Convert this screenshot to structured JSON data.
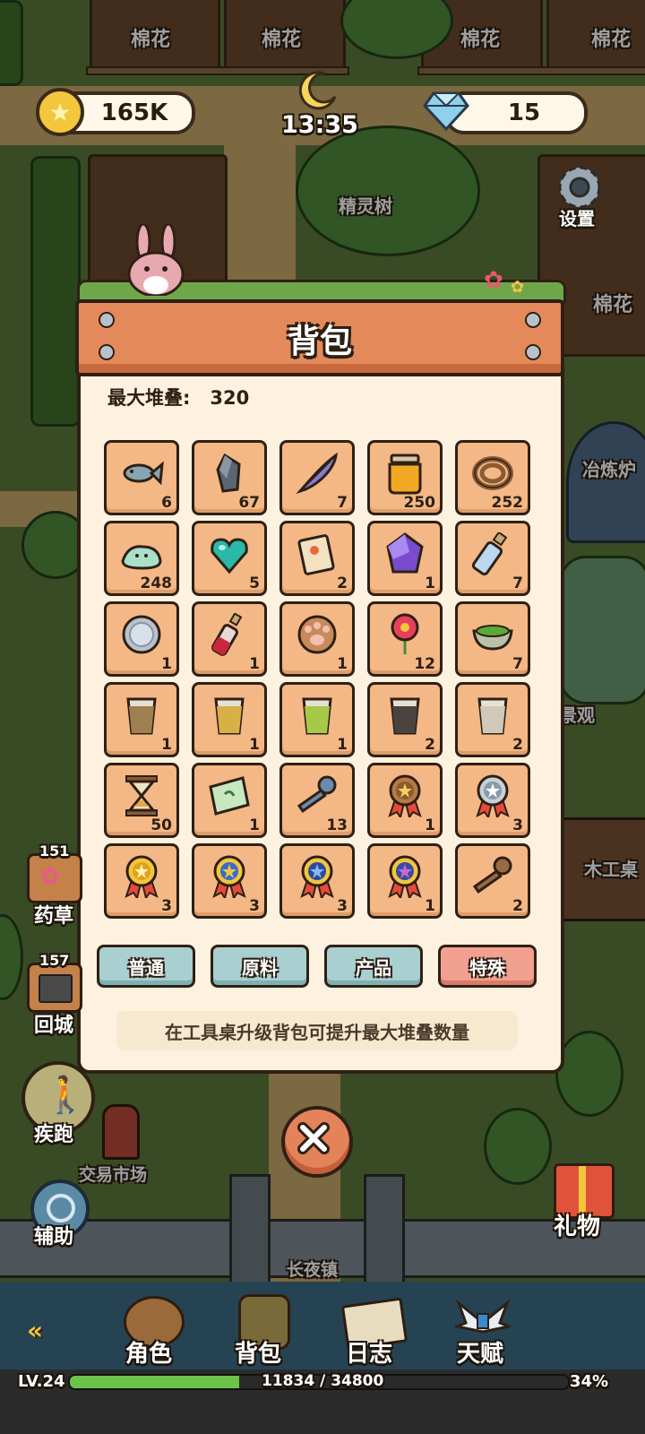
{
  "hud": {
    "coins": "165K",
    "time": "13:35",
    "gems": "15",
    "settings_label": "设置"
  },
  "map_labels": {
    "cotton_1": "棉花",
    "cotton_2": "棉花",
    "cotton_3": "棉花",
    "cotton_4": "棉花",
    "cotton_5": "棉花",
    "spirit_tree": "精灵树",
    "smelting": "冶炼炉",
    "scenery": "景观",
    "workbench": "木工桌",
    "trade_market": "交易市场",
    "town": "长夜镇"
  },
  "side_buttons": {
    "herb_count": "151",
    "herb_label": "药草",
    "return_count": "157",
    "return_label": "回城",
    "sprint_label": "疾跑",
    "assist_label": "辅助",
    "gift_label": "礼物"
  },
  "panel": {
    "title": "背包",
    "max_stack_label": "最大堆叠:",
    "max_stack_value": "320",
    "items": [
      {
        "name": "fish-icon",
        "qty": "6"
      },
      {
        "name": "stone-icon",
        "qty": "67"
      },
      {
        "name": "feather-icon",
        "qty": "7"
      },
      {
        "name": "honey-jar-icon",
        "qty": "250"
      },
      {
        "name": "rope-icon",
        "qty": "252"
      },
      {
        "name": "slime-icon",
        "qty": "248"
      },
      {
        "name": "heart-gem-icon",
        "qty": "5"
      },
      {
        "name": "scroll-card-icon",
        "qty": "2"
      },
      {
        "name": "purple-crystal-icon",
        "qty": "1"
      },
      {
        "name": "blue-bottle-icon",
        "qty": "7"
      },
      {
        "name": "silver-coin-icon",
        "qty": "1"
      },
      {
        "name": "red-bottle-icon",
        "qty": "1"
      },
      {
        "name": "paw-icon",
        "qty": "1"
      },
      {
        "name": "red-flower-icon",
        "qty": "12"
      },
      {
        "name": "herb-bowl-icon",
        "qty": "7"
      },
      {
        "name": "cup-brown-icon",
        "qty": "1"
      },
      {
        "name": "cup-yellow-icon",
        "qty": "1"
      },
      {
        "name": "cup-green-icon",
        "qty": "1"
      },
      {
        "name": "cup-dark-icon",
        "qty": "2"
      },
      {
        "name": "cup-white-icon",
        "qty": "2"
      },
      {
        "name": "hourglass-icon",
        "qty": "50"
      },
      {
        "name": "map-ticket-icon",
        "qty": "1"
      },
      {
        "name": "key-blue-icon",
        "qty": "13"
      },
      {
        "name": "medal-bronze-icon",
        "qty": "1"
      },
      {
        "name": "medal-silver-icon",
        "qty": "3"
      },
      {
        "name": "medal-gold-icon",
        "qty": "3"
      },
      {
        "name": "medal-gold-blue-icon",
        "qty": "3"
      },
      {
        "name": "medal-blue-icon",
        "qty": "3"
      },
      {
        "name": "medal-purple-icon",
        "qty": "1"
      },
      {
        "name": "key-bronze-icon",
        "qty": "2"
      }
    ],
    "tabs": [
      "普通",
      "原料",
      "产品",
      "特殊"
    ],
    "active_tab": "特殊",
    "hint": "在工具桌升级背包可提升最大堆叠数量"
  },
  "bottom_nav": {
    "items": [
      "角色",
      "背包",
      "日志",
      "天赋"
    ],
    "level": "LV.24",
    "xp_text": "11834 / 34800",
    "xp_percent": "34%",
    "xp_fraction": 0.34
  },
  "colors": {
    "panel_bg": "#fdf2df",
    "slot_bg": "#f4b886",
    "title_board": "#e48a5a",
    "tab_normal": "#a9cfd0",
    "tab_active": "#f2a090"
  }
}
